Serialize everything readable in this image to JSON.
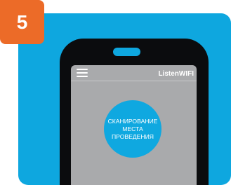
{
  "step": {
    "number": "5"
  },
  "app": {
    "menu_icon": "hamburger-menu-icon",
    "title": "ListenWIFI"
  },
  "scan_button": {
    "line1": "СКАНИРОВАНИЕ",
    "line2": "МЕСТА",
    "line3": "ПРОВЕДЕНИЯ"
  },
  "colors": {
    "panel": "#0ea7df",
    "badge": "#ec6b28",
    "phone": "#0b0c0e",
    "screen": "#a9aaac",
    "button": "#0fa8e0"
  }
}
